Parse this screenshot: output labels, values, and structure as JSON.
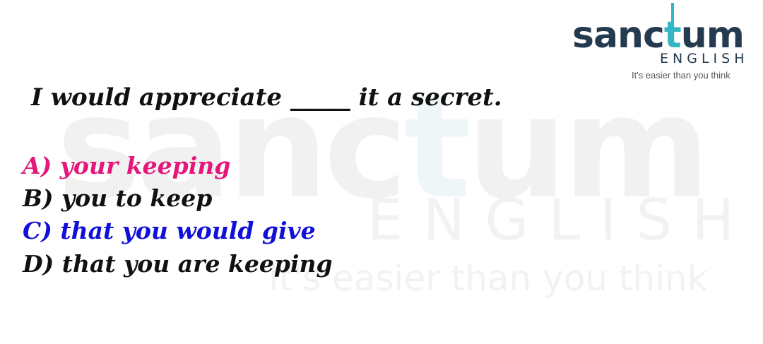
{
  "logo": {
    "word_start": "sanc",
    "word_t": "t",
    "word_end": "um",
    "sub": "ENGLISH",
    "tagline": "It's easier than you think"
  },
  "question": "I would appreciate _____ it a secret.",
  "options": [
    {
      "label": "A) your keeping",
      "color": "#e5177b"
    },
    {
      "label": "B) you to keep",
      "color": "#111111"
    },
    {
      "label": "C) that you would give",
      "color": "#1010d8"
    },
    {
      "label": "D) that you are keeping",
      "color": "#111111"
    }
  ]
}
